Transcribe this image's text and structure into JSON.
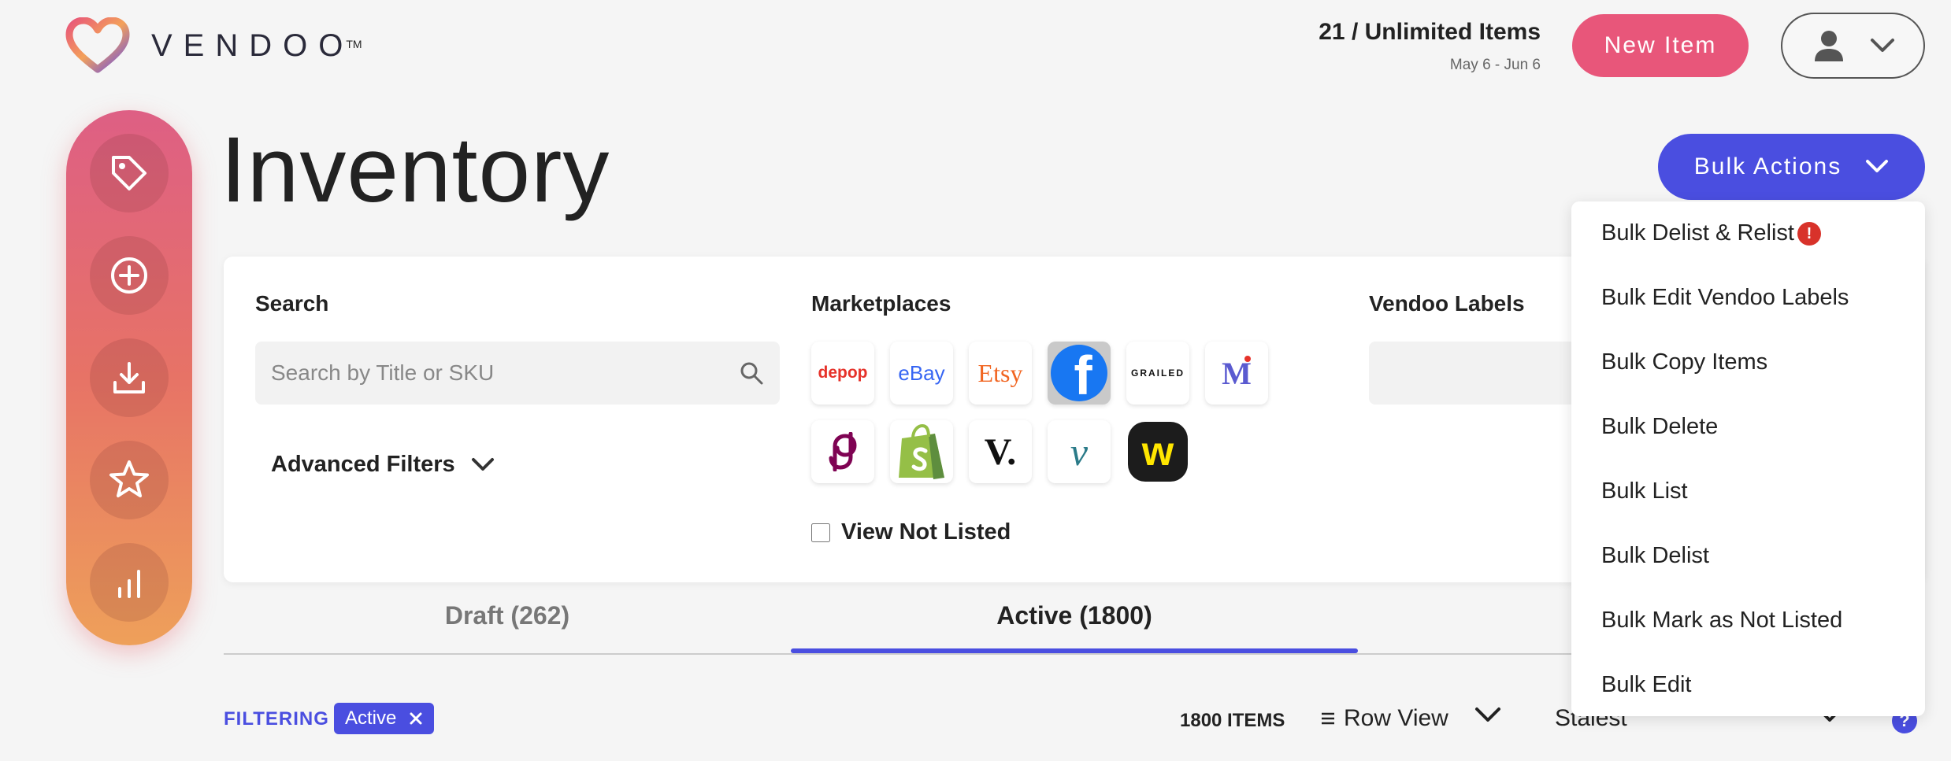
{
  "brand": {
    "name": "VENDOO",
    "tm": "TM"
  },
  "header": {
    "items_count": "21 / Unlimited Items",
    "date_range": "May 6 - Jun 6",
    "new_item_label": "New Item"
  },
  "sidebar": {
    "items": [
      {
        "icon": "tag-icon"
      },
      {
        "icon": "plus-circle-icon"
      },
      {
        "icon": "download-icon"
      },
      {
        "icon": "star-icon"
      },
      {
        "icon": "bar-chart-icon"
      }
    ]
  },
  "page": {
    "title": "Inventory",
    "bulk_actions_label": "Bulk Actions"
  },
  "filters": {
    "search_label": "Search",
    "search_placeholder": "Search by Title or SKU",
    "advanced_filters_label": "Advanced Filters",
    "marketplaces_label": "Marketplaces",
    "marketplaces": [
      {
        "name": "depop",
        "text": "depop",
        "color": "#e6322a"
      },
      {
        "name": "ebay",
        "text": "eBay",
        "color": "#3665f3"
      },
      {
        "name": "etsy",
        "text": "Etsy",
        "color": "#f16521"
      },
      {
        "name": "facebook",
        "text": "f",
        "color": "#1877f2",
        "selected": true
      },
      {
        "name": "grailed",
        "text": "GRAILED",
        "color": "#000000"
      },
      {
        "name": "mercari",
        "text": "M",
        "color": "#5a5ad0"
      },
      {
        "name": "poshmark",
        "text": "",
        "color": "#7f0353"
      },
      {
        "name": "shopify",
        "text": "",
        "color": "#95bf47"
      },
      {
        "name": "vestiaire",
        "text": "V.",
        "color": "#111111"
      },
      {
        "name": "vinted",
        "text": "v",
        "color": "#2b7b89"
      },
      {
        "name": "whatnot",
        "text": "w",
        "color": "#ffe600"
      }
    ],
    "view_not_listed_label": "View Not Listed",
    "vendoo_labels_label": "Vendoo Labels"
  },
  "tabs": [
    {
      "label": "Draft (262)",
      "active": false
    },
    {
      "label": "Active (1800)",
      "active": true
    }
  ],
  "toolbar": {
    "filtering_label": "FILTERING",
    "chip_label": "Active",
    "items_count": "1800 ITEMS",
    "view_label": "Row View",
    "sort_label": "Stalest",
    "help_label": "?"
  },
  "bulk_menu": {
    "items": [
      {
        "label": "Bulk Delist & Relist",
        "alert": true
      },
      {
        "label": "Bulk Edit Vendoo Labels"
      },
      {
        "label": "Bulk Copy Items"
      },
      {
        "label": "Bulk Delete"
      },
      {
        "label": "Bulk List"
      },
      {
        "label": "Bulk Delist"
      },
      {
        "label": "Bulk Mark as Not Listed"
      },
      {
        "label": "Bulk Edit"
      }
    ],
    "alert_symbol": "!"
  },
  "colors": {
    "accent": "#4a4ee0",
    "brand_pink": "#e8567a",
    "alert_red": "#d8322a"
  }
}
